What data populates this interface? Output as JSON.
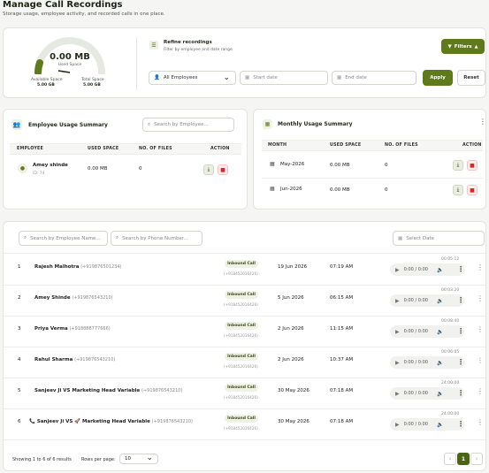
{
  "page": {
    "title": "Manage Call Recordings",
    "subtitle": "Storage usage, employee activity, and recorded calls in one place."
  },
  "storage": {
    "value": "0.00 MB",
    "label": "Used Space",
    "used_fraction": 0.02,
    "available_label": "Available Space",
    "available_value": "5.00 GB",
    "total_label": "Total Space",
    "total_value": "5.00 GB"
  },
  "refine": {
    "title": "Refine recordings",
    "subtitle": "Filter by employee and date range",
    "filters_label": "Filters",
    "employee_select": "All Employees",
    "start_placeholder": "Start date",
    "end_placeholder": "End date",
    "apply_label": "Apply",
    "reset_label": "Reset"
  },
  "employee_summary": {
    "title": "Employee Usage Summary",
    "search_placeholder": "Search by Employee...",
    "headers": [
      "EMPLOYEE",
      "USED SPACE",
      "NO. OF FILES",
      "ACTION"
    ],
    "rows": [
      {
        "name": "Amey shinde",
        "id": "ID: 74",
        "space": "0.00 MB",
        "files": "0"
      }
    ]
  },
  "monthly_summary": {
    "title": "Monthly Usage Summary",
    "headers": [
      "MONTH",
      "USED SPACE",
      "NO. OF FILES",
      "ACTION"
    ],
    "rows": [
      {
        "month": "May-2026",
        "space": "0.00 MB",
        "files": "0"
      },
      {
        "month": "Jun-2026",
        "space": "0.00 MB",
        "files": "0"
      }
    ]
  },
  "recordings": {
    "search_employee_placeholder": "Search by Employee Name...",
    "search_phone_placeholder": "Search by Phone Number...",
    "date_placeholder": "Select Date",
    "rows": [
      {
        "idx": "1",
        "name": "Rajesh Malhotra",
        "phone": "(+919876501234)",
        "type": "Inbound Call",
        "type_phone": "(+918452016426)",
        "date": "19 Jun 2026",
        "time": "07:19 AM",
        "duration": "00:05:12",
        "player": "0:00 / 0:00",
        "icon": ""
      },
      {
        "idx": "2",
        "name": "Amey Shinde",
        "phone": "(+919876543210)",
        "type": "Inbound Call",
        "type_phone": "(+918452016426)",
        "date": "5 Jun 2026",
        "time": "06:15 AM",
        "duration": "00:03:20",
        "player": "0:00 / 0:00",
        "icon": ""
      },
      {
        "idx": "3",
        "name": "Priya Verma",
        "phone": "(+918888777666)",
        "type": "Inbound Call",
        "type_phone": "(+918452016426)",
        "date": "2 Jun 2026",
        "time": "11:15 AM",
        "duration": "00:08:40",
        "player": "0:00 / 0:00",
        "icon": ""
      },
      {
        "idx": "4",
        "name": "Rahul Sharma",
        "phone": "(+919876543210)",
        "type": "Inbound Call",
        "type_phone": "(+918452016426)",
        "date": "2 Jun 2026",
        "time": "10:37 AM",
        "duration": "00:06:05",
        "player": "0:00 / 0:00",
        "icon": ""
      },
      {
        "idx": "5",
        "name": "Sanjeev Ji VS Marketing Head Variable",
        "phone": "(+919876543210)",
        "type": "Inbound Call",
        "type_phone": "(+918452016426)",
        "date": "30 May 2026",
        "time": "07:18 AM",
        "duration": "24:00:00",
        "player": "0:00 / 0:00",
        "icon": ""
      },
      {
        "idx": "6",
        "name": "Sanjeev Ji VS 🚀 Marketing Head Variable",
        "phone": "(+919876543210)",
        "type": "Inbound Call",
        "type_phone": "(+918452016426)",
        "date": "30 May 2026",
        "time": "07:18 AM",
        "duration": "24:00:00",
        "player": "0:00 / 0:00",
        "icon": "📞"
      }
    ]
  },
  "footer": {
    "showing": "Showing 1 to 6 of 6 results",
    "rows_label": "Rows per page:",
    "rows_value": "10",
    "page": "1"
  },
  "colors": {
    "accent": "#5e7a1c",
    "accent_dark": "#4a6414",
    "danger": "#e02424"
  }
}
